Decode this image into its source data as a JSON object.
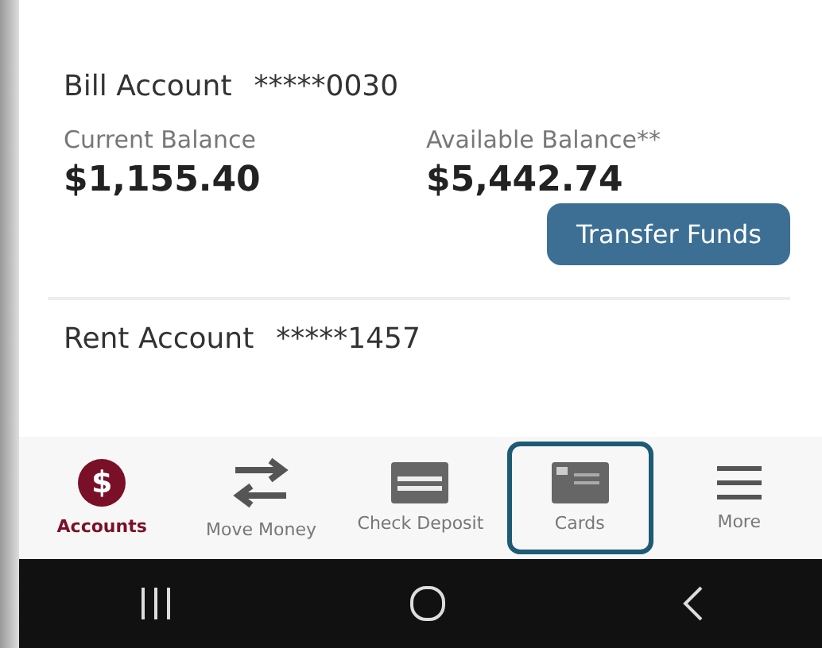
{
  "accounts": [
    {
      "name": "Bill Account",
      "number": "*****0030",
      "current_label": "Current Balance",
      "current_value": "$1,155.40",
      "available_label": "Available Balance**",
      "available_value": "$5,442.74",
      "button": "Transfer Funds"
    },
    {
      "name": "Rent Account",
      "number": "*****1457"
    }
  ],
  "nav": [
    {
      "label": "Accounts",
      "kind": "dollar",
      "glyph": "$",
      "selected": true,
      "focused": false
    },
    {
      "label": "Move Money",
      "kind": "transfer",
      "selected": false,
      "focused": false
    },
    {
      "label": "Check Deposit",
      "kind": "check",
      "selected": false,
      "focused": false
    },
    {
      "label": "Cards",
      "kind": "card",
      "selected": false,
      "focused": true
    },
    {
      "label": "More",
      "kind": "menu",
      "selected": false,
      "focused": false
    }
  ],
  "system_nav": [
    {
      "kind": "recents"
    },
    {
      "kind": "home"
    },
    {
      "kind": "back"
    }
  ]
}
